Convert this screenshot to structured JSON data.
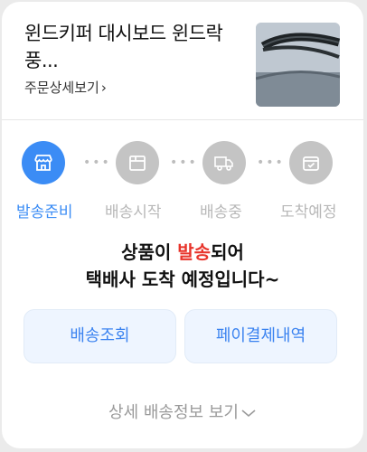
{
  "product": {
    "title": "윈드키퍼 대시보드 윈드락 풍...",
    "order_link": "주문상세보기"
  },
  "steps": [
    {
      "label": "발송준비",
      "icon": "store-icon",
      "active": true
    },
    {
      "label": "배송시작",
      "icon": "box-icon",
      "active": false
    },
    {
      "label": "배송중",
      "icon": "truck-icon",
      "active": false
    },
    {
      "label": "도착예정",
      "icon": "check-box-icon",
      "active": false
    }
  ],
  "status": {
    "line1_pre": "상품이 ",
    "line1_highlight": "발송",
    "line1_post": "되어",
    "line2": "택배사 도착 예정입니다~"
  },
  "buttons": {
    "tracking": "배송조회",
    "payment": "페이결제내역"
  },
  "more": {
    "label": "상세 배송정보 보기"
  },
  "colors": {
    "accent": "#3b8cf5",
    "highlight": "#e8342b",
    "inactive": "#c4c4c4"
  }
}
